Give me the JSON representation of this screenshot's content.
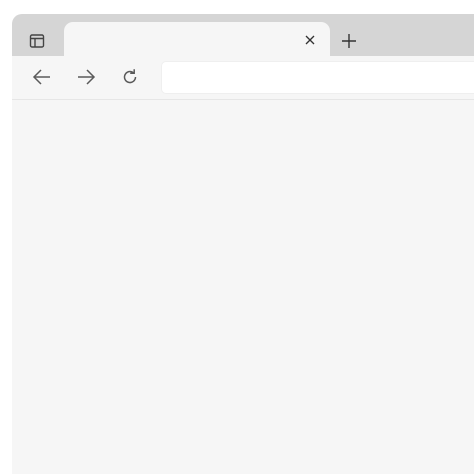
{
  "browser": {
    "tab": {
      "title": "",
      "close_icon": "close-icon"
    },
    "tab_actions_icon": "tab-actions-icon",
    "new_tab_icon": "plus-icon",
    "nav": {
      "back_icon": "arrow-left-icon",
      "forward_icon": "arrow-right-icon",
      "reload_icon": "refresh-icon"
    },
    "address_bar": {
      "value": "",
      "placeholder": ""
    }
  },
  "colors": {
    "tabstrip": "#d5d5d5",
    "toolbar": "#f6f6f6",
    "address_bar": "#ffffff",
    "icon": "#5a5a5a"
  }
}
